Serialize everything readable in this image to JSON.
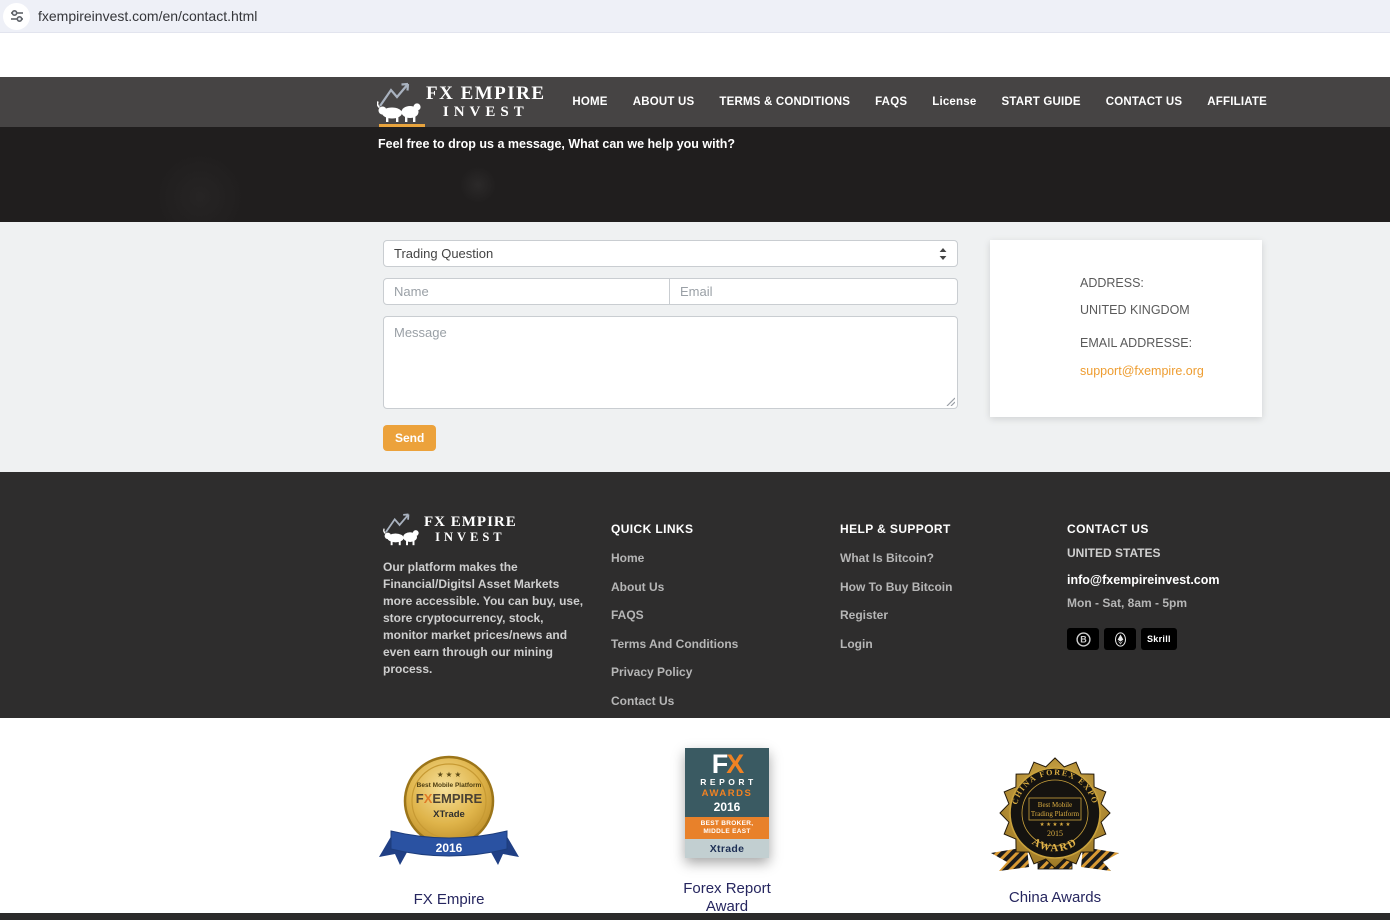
{
  "browser": {
    "url": "fxempireinvest.com/en/contact.html"
  },
  "header": {
    "logo_line1": "FX EMPIRE",
    "logo_line2": "INVEST",
    "nav": [
      "HOME",
      "ABOUT US",
      "TERMS & CONDITIONS",
      "FAQS",
      "License",
      "START GUIDE",
      "CONTACT US",
      "AFFILIATE"
    ]
  },
  "hero": {
    "message": "Feel free to drop us a message, What can we help you with?"
  },
  "contact_form": {
    "subject_selected": "Trading Question",
    "name_placeholder": "Name",
    "email_placeholder": "Email",
    "message_placeholder": "Message",
    "send_label": "Send"
  },
  "info_panel": {
    "address_label": "ADDRESS:",
    "address_value": "UNITED KINGDOM",
    "email_label": "EMAIL ADDRESSE:",
    "email_link": "support@fxempire.org"
  },
  "footer": {
    "logo_line1": "FX EMPIRE",
    "logo_line2": "INVEST",
    "description": "Our platform makes the Financial/Digitsl Asset Markets more accessible. You can buy, use, store cryptocurrency, stock, monitor market prices/news and even earn through our mining process.",
    "quick_links": {
      "title": "QUICK LINKS",
      "items": [
        "Home",
        "About Us",
        "FAQS",
        "Terms And Conditions",
        "Privacy Policy",
        "Contact Us"
      ]
    },
    "help_support": {
      "title": "HELP & SUPPORT",
      "items": [
        "What Is Bitcoin?",
        "How To Buy Bitcoin",
        "Register",
        "Login"
      ]
    },
    "contact": {
      "title": "CONTACT US",
      "country": "UNITED STATES",
      "email": "info@fxempireinvest.com",
      "hours": "Mon - Sat, 8am - 5pm",
      "payments": [
        "bitcoin",
        "ethereum",
        "skrill"
      ],
      "skrill_label": "Skrill"
    }
  },
  "awards": {
    "fx_empire": {
      "label": "FX Empire",
      "stars": "★ ★ ★",
      "medal_top": "Best Mobile Platform",
      "brand_f": "F",
      "brand_x": "X",
      "brand_rest": "EMPIRE",
      "product": "XTrade",
      "year": "2016"
    },
    "forex_report": {
      "label": "Forex Report Award",
      "fx_f": "F",
      "fx_x": "X",
      "report": "REPORT",
      "awards_word": "AWARDS",
      "year": "2016",
      "band_line1": "BEST BROKER,",
      "band_line2": "MIDDLE EAST",
      "brand": "Xtrade"
    },
    "china": {
      "label": "China Awards",
      "arc_text": "CHINA FOREX EXPO",
      "line1": "Best Mobile",
      "line2": "Trading Platform",
      "stars": "★ ★ ★ ★ ★",
      "year": "2015",
      "bottom_text": "AWARD"
    }
  },
  "colors": {
    "accent_orange": "#eca23b",
    "link_orange": "#ee9d31",
    "nav_bg": "#464444",
    "hero_bg": "#201e1e",
    "section_bg": "#eff1f2",
    "footer_bg": "#2e2d2d",
    "award_label": "#26265f",
    "badge_teal": "#3a5a62",
    "badge_orange": "#e8812a"
  }
}
